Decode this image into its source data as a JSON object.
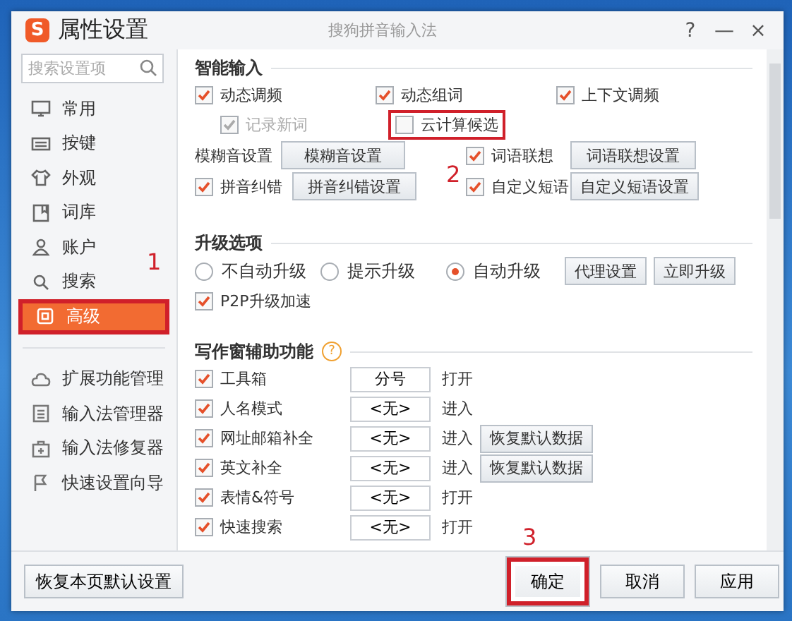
{
  "window": {
    "logo": "S",
    "title": "属性设置",
    "app_name": "搜狗拼音输入法",
    "help": "?",
    "minimize": "—",
    "close": "×"
  },
  "sidebar": {
    "search": {
      "placeholder": "搜索设置项"
    },
    "items": [
      {
        "label": "常用",
        "selected": false,
        "marked": false
      },
      {
        "label": "按键",
        "selected": false,
        "marked": false
      },
      {
        "label": "外观",
        "selected": false,
        "marked": false
      },
      {
        "label": "词库",
        "selected": false,
        "marked": false
      },
      {
        "label": "账户",
        "selected": false,
        "marked": false
      },
      {
        "label": "搜索",
        "selected": false,
        "marked": false
      },
      {
        "label": "高级",
        "selected": true,
        "marked": true
      }
    ],
    "tools": [
      {
        "label": "扩展功能管理"
      },
      {
        "label": "输入法管理器"
      },
      {
        "label": "输入法修复器"
      },
      {
        "label": "快速设置向导"
      }
    ]
  },
  "smart_input": {
    "title": "智能输入",
    "options": [
      {
        "label": "动态调频",
        "checked": true,
        "disabled": false,
        "marked": false
      },
      {
        "label": "动态组词",
        "checked": true,
        "disabled": false,
        "marked": false
      },
      {
        "label": "上下文调频",
        "checked": true,
        "disabled": false,
        "marked": false
      },
      {
        "label": "记录新词",
        "checked": true,
        "disabled": true,
        "marked": false
      },
      {
        "label": "云计算候选",
        "checked": false,
        "disabled": false,
        "marked": true
      }
    ],
    "fuzzy": {
      "label": "模糊音设置",
      "button": "模糊音设置"
    },
    "correction": {
      "label": "拼音纠错",
      "checked": true,
      "button": "拼音纠错设置"
    },
    "association": {
      "label": "词语联想",
      "checked": true,
      "button": "词语联想设置"
    },
    "phrases": {
      "label": "自定义短语",
      "checked": true,
      "button": "自定义短语设置"
    }
  },
  "upgrade": {
    "title": "升级选项",
    "modes": [
      {
        "label": "不自动升级",
        "selected": false
      },
      {
        "label": "提示升级",
        "selected": false
      },
      {
        "label": "自动升级",
        "selected": true
      }
    ],
    "buttons": [
      "代理设置",
      "立即升级"
    ],
    "p2p": {
      "label": "P2P升级加速",
      "checked": true
    }
  },
  "writing": {
    "title": "写作窗辅助功能",
    "help": "?",
    "rows": [
      {
        "label": "工具箱",
        "checked": true,
        "hotkey": "分号",
        "action": "打开"
      },
      {
        "label": "人名模式",
        "checked": true,
        "hotkey": "<无>",
        "action": "进入"
      },
      {
        "label": "网址邮箱补全",
        "checked": true,
        "hotkey": "<无>",
        "action": "进入",
        "button": "恢复默认数据"
      },
      {
        "label": "英文补全",
        "checked": true,
        "hotkey": "<无>",
        "action": "进入",
        "button": "恢复默认数据"
      },
      {
        "label": "表情&符号",
        "checked": true,
        "hotkey": "<无>",
        "action": "打开"
      },
      {
        "label": "快速搜索",
        "checked": true,
        "hotkey": "<无>",
        "action": "打开"
      }
    ]
  },
  "footer": {
    "restore": "恢复本页默认设置",
    "buttons": [
      {
        "label": "确定",
        "marked": true
      },
      {
        "label": "取消",
        "marked": false
      },
      {
        "label": "应用",
        "marked": false
      }
    ]
  },
  "annotations": [
    {
      "label": "1"
    },
    {
      "label": "2"
    },
    {
      "label": "3"
    }
  ]
}
